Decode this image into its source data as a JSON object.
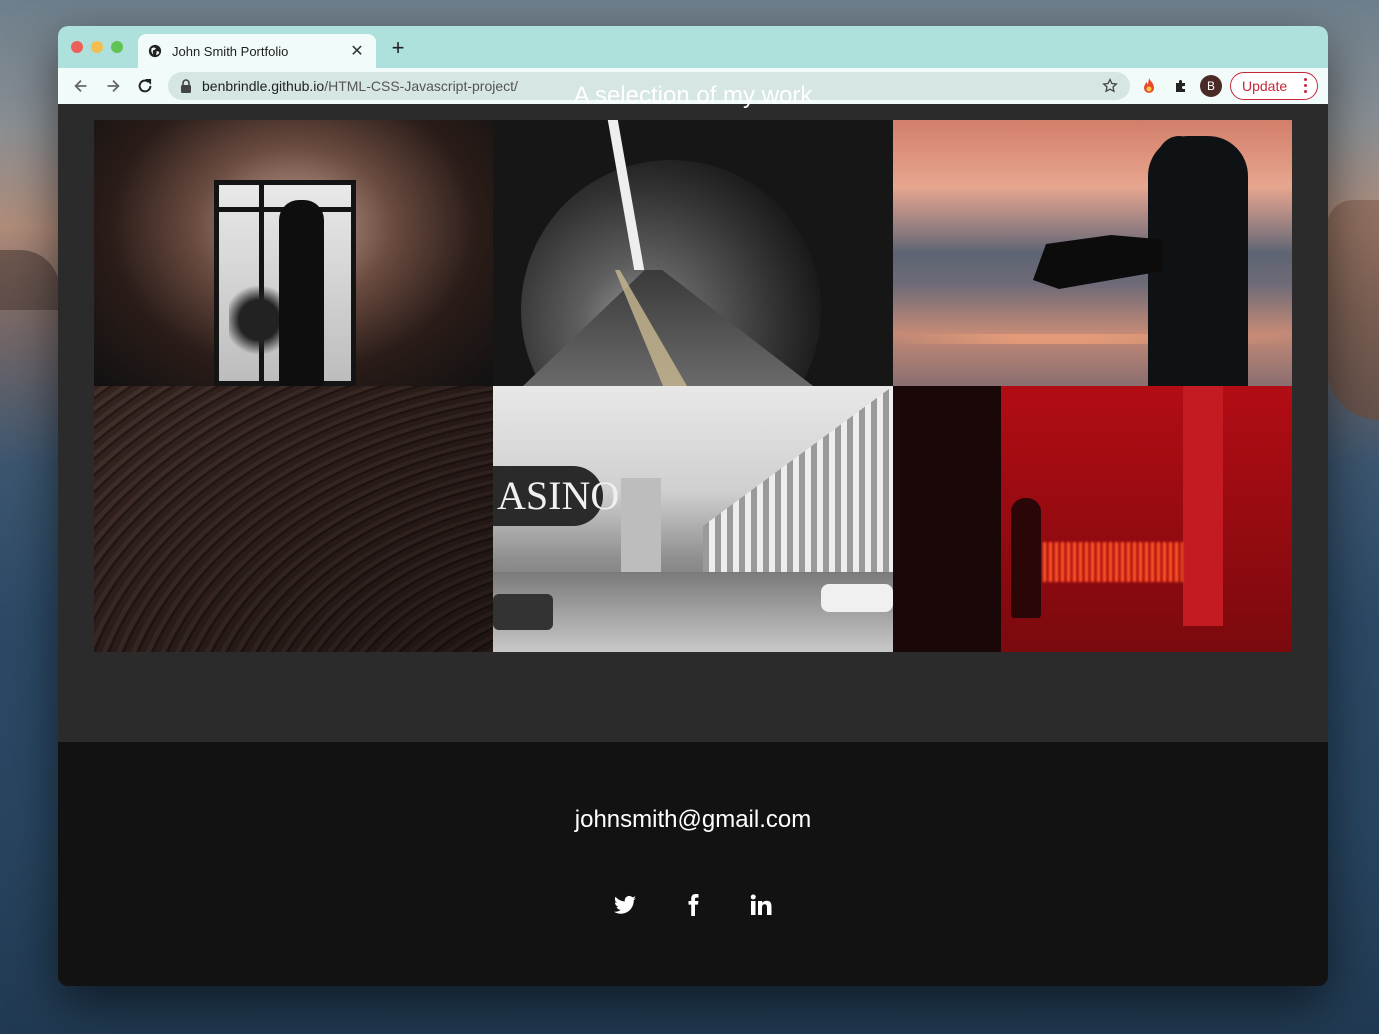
{
  "browser": {
    "tab_title": "John Smith Portfolio",
    "url_host": "benbrindle.github.io",
    "url_path": "/HTML-CSS-Javascript-project/",
    "profile_initial": "B",
    "update_label": "Update",
    "accent_color": "#c6293a",
    "titlebar_color": "#aee0dc"
  },
  "page": {
    "section_heading": "A selection of my work",
    "gallery": [
      {
        "icon": "corridor-silhouette-photo"
      },
      {
        "icon": "tunnel-photo"
      },
      {
        "icon": "camera-operator-sunset-photo"
      },
      {
        "icon": "wooden-curves-photo"
      },
      {
        "icon": "casino-street-photo"
      },
      {
        "icon": "red-room-photo"
      }
    ],
    "footer": {
      "email": "johnsmith@gmail.com",
      "socials": [
        "twitter-icon",
        "facebook-icon",
        "linkedin-icon"
      ]
    }
  }
}
